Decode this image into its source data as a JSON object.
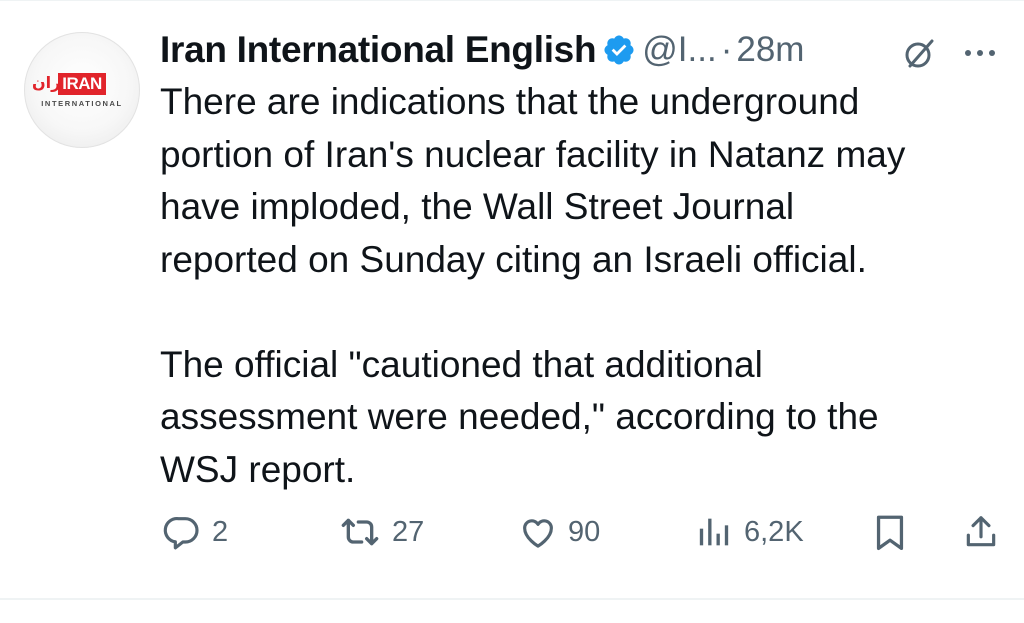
{
  "account": {
    "display_name": "Iran International English",
    "handle": "@I...",
    "separator": "·",
    "timestamp": "28m",
    "verified": true,
    "avatar": {
      "logo_text": "IRAN",
      "logo_text_farsi": "ایران",
      "logo_subtitle": "INTERNATIONAL",
      "brand_color": "#e1242b"
    }
  },
  "tweet": {
    "text": "There are indications that the underground\nportion of Iran's nuclear facility in Natanz may\nhave imploded, the Wall Street Journal\nreported on Sunday citing an Israeli official.\n\nThe official \"cautioned that additional\nassessment were needed,\" according to the\nWSJ report."
  },
  "actions": {
    "replies": "2",
    "reposts": "27",
    "likes": "90",
    "views": "6,2K"
  },
  "icons": {
    "verified": "verified-badge-icon",
    "grok": "grok-icon",
    "more": "more-options-icon",
    "reply": "reply-icon",
    "repost": "repost-icon",
    "like": "heart-icon",
    "views": "views-chart-icon",
    "bookmark": "bookmark-icon",
    "share": "share-icon"
  },
  "colors": {
    "text": "#0f1419",
    "secondary": "#536471",
    "verified": "#1d9bf0",
    "divider": "#eff3f4"
  }
}
